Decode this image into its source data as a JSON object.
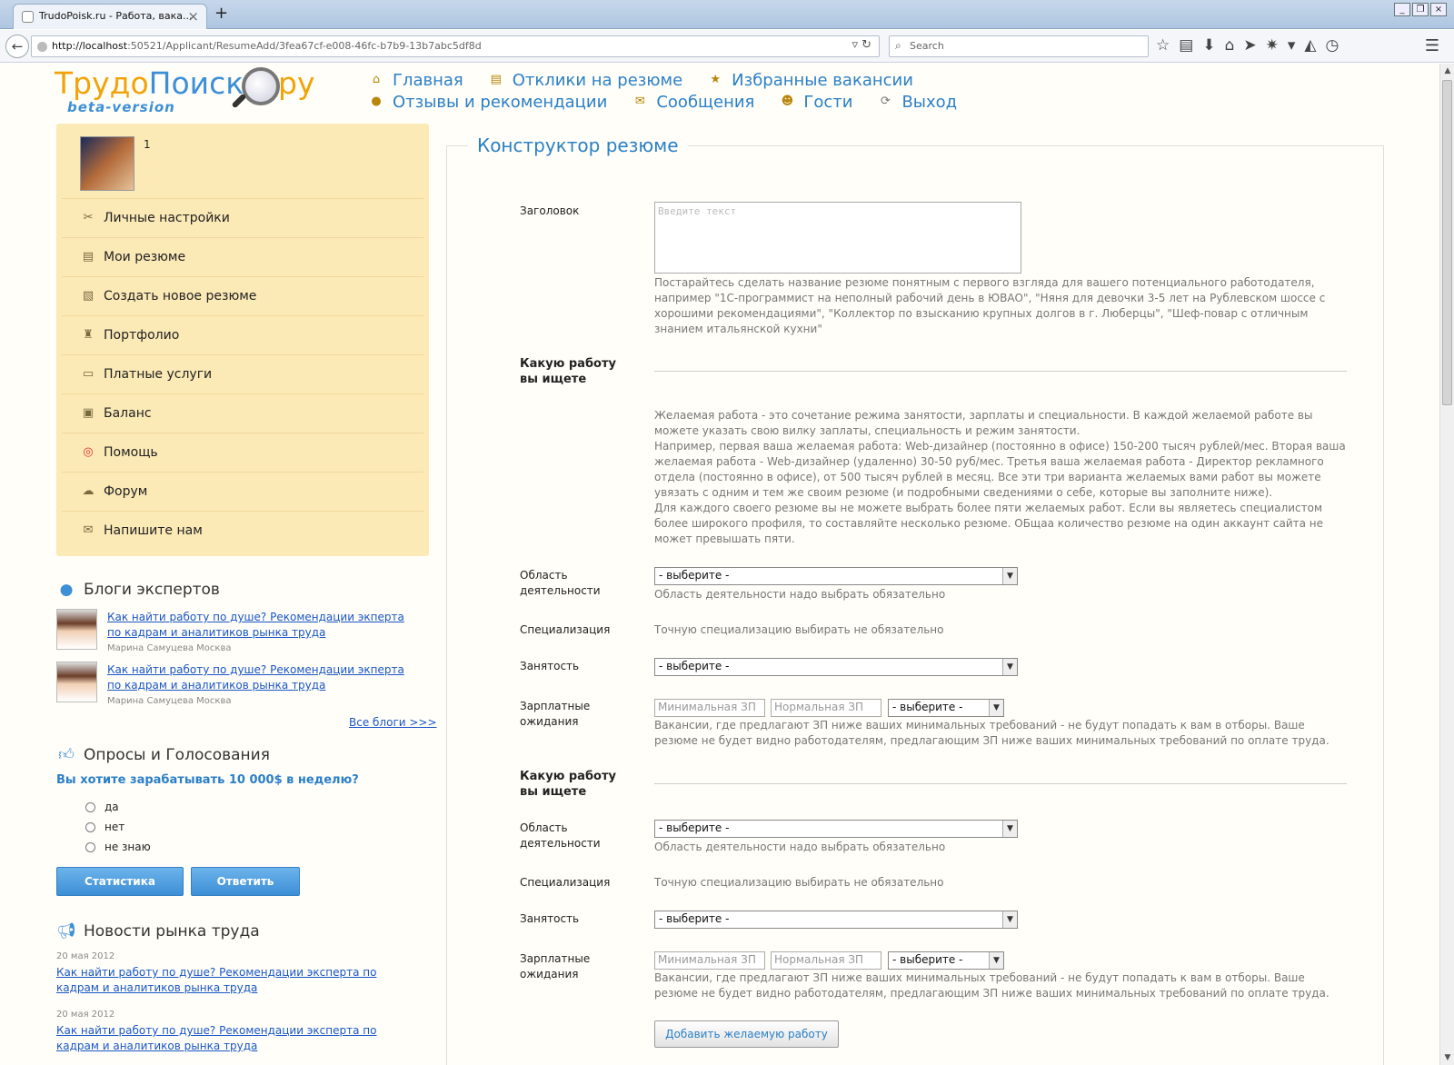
{
  "browser": {
    "tab_title": "TrudoPoisk.ru - Работа, вака...",
    "url_host": "http://localhost",
    "url_path": ":50521/Applicant/ResumeAdd/3fea67cf-e008-46fc-b7b9-13b7abc5df8d",
    "search_placeholder": "Search"
  },
  "logo": {
    "part1": "Трудо",
    "part2": "Поиск",
    "part3": "ру",
    "beta": "beta-version"
  },
  "topnav": {
    "row1": [
      {
        "label": "Главная",
        "icon": "home-icon"
      },
      {
        "label": "Отклики на резюме",
        "icon": "document-icon"
      },
      {
        "label": "Избранные вакансии",
        "icon": "star-icon"
      }
    ],
    "row2": [
      {
        "label": "Отзывы и рекомендации",
        "icon": "chat-icon"
      },
      {
        "label": "Сообщения",
        "icon": "mail-icon"
      },
      {
        "label": "Гости",
        "icon": "guests-icon"
      },
      {
        "label": "Выход",
        "icon": "exit-icon"
      }
    ]
  },
  "sidebar": {
    "username": "1",
    "items": [
      {
        "label": "Личные настройки",
        "icon": "tools-icon"
      },
      {
        "label": "Мои резюме",
        "icon": "resume-icon"
      },
      {
        "label": "Создать новое резюме",
        "icon": "new-resume-icon"
      },
      {
        "label": "Портфолио",
        "icon": "trophy-icon"
      },
      {
        "label": "Платные услуги",
        "icon": "card-icon"
      },
      {
        "label": "Баланс",
        "icon": "wallet-icon"
      },
      {
        "label": "Помощь",
        "icon": "lifebuoy-icon"
      },
      {
        "label": "Форум",
        "icon": "forum-icon"
      },
      {
        "label": "Напишите нам",
        "icon": "envelope-icon"
      }
    ]
  },
  "blogs": {
    "title": "Блоги экспертов",
    "items": [
      {
        "title": "Как найти работу по душе? Рекомендации экперта по кадрам и аналитиков рынка труда",
        "author": "Марина Самуцева Москва"
      },
      {
        "title": "Как найти работу по душе? Рекомендации экперта по кадрам и аналитиков рынка труда",
        "author": "Марина Самуцева Москва"
      }
    ],
    "all_link": "Все блоги >>>"
  },
  "poll": {
    "title": "Опросы и Голосования",
    "question": "Вы хотите зарабатывать 10 000$ в неделю?",
    "options": [
      "да",
      "нет",
      "не знаю"
    ],
    "stats_button": "Статистика",
    "answer_button": "Ответить"
  },
  "news": {
    "title": "Новости рынка труда",
    "items": [
      {
        "date": "20 мая 2012",
        "title": "Как найти работу по душе? Рекомендации эксперта по кадрам и аналитиков рынка труда"
      },
      {
        "date": "20 мая 2012",
        "title": "Как найти работу по душе? Рекомендации эксперта по кадрам и аналитиков рынка труда"
      }
    ]
  },
  "form": {
    "title": "Конструктор резюме",
    "heading_label": "Заголовок",
    "heading_placeholder": "Введите текст",
    "heading_hint": "Постарайтесь сделать название резюме понятным с первого взгляда для вашего потенциального работодателя, например \"1С-программист на неполный рабочий день в ЮВАО\", \"Няня для девочки 3-5 лет на Рублевском шоссе с хорошими рекомендациями\", \"Коллектор по взысканию крупных долгов в г. Люберцы\", \"Шеф-повар с отличным знанием итальянской кухни\"",
    "job_section_label": "Какую работу вы ищете",
    "job_hint_1": "Желаемая работа - это сочетание режима занятости, зарплаты и специальности. В каждой желаемой работе вы можете указать свою вилку заплаты, специальность и режим занятости.",
    "job_hint_2": "Например, первая ваша желаемая работа: Web-дизайнер (постоянно в офисе) 150-200 тысяч рублей/мес. Вторая ваша желаемая работа - Web-дизайнер (удаленно) 30-50 руб/мес. Третья ваша желаемая работа - Директор рекламного отдела (постоянно в офисе), от 500 тысяч рублей в месяц. Все эти три варианта желаемых вами работ вы можете увязать с одним и тем же своим резюме (и подробными сведениями о себе, которые вы заполните ниже).",
    "job_hint_3": "Для каждого своего резюме вы не можете выбрать более пяти желаемых работ. Если вы являетесь специалистом более широкого профиля, то составляйте несколько резюме. ОБщаа количество резюме на один аккаунт сайта не может превышать пяти.",
    "area_label": "Область деятельности",
    "area_hint": "Область деятельности надо выбрать обязательно",
    "spec_label": "Специализация",
    "spec_hint": "Точную специализацию выбирать не обязательно",
    "employment_label": "Занятость",
    "salary_label": "Зарплатные ожидания",
    "select_default": "- выберите -",
    "min_salary_placeholder": "Минимальная ЗП",
    "normal_salary_placeholder": "Нормальная ЗП",
    "salary_hint": "Вакансии, где предлагают ЗП ниже ваших минимальных требований - не будут попадать к вам в отборы. Ваше резюме не будет видно работодателям, предлагающим ЗП ниже ваших минимальных требований по оплате труда.",
    "add_button": "Добавить желаемую работу"
  }
}
